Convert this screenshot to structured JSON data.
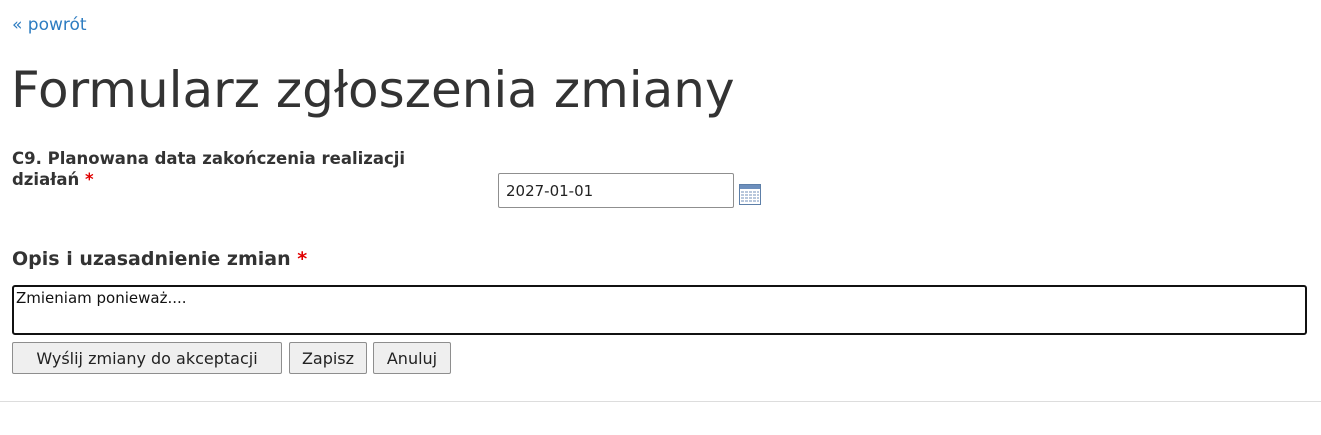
{
  "nav": {
    "back_label": "« powrót"
  },
  "page": {
    "title": "Formularz zgłoszenia zmiany"
  },
  "fields": {
    "end_date": {
      "label": "C9. Planowana data zakończenia realizacji działań",
      "required_mark": "*",
      "value": "2027-01-01",
      "icon": "calendar-icon"
    },
    "description": {
      "label": "Opis i uzasadnienie zmian",
      "required_mark": "*",
      "value": "Zmieniam ponieważ...."
    }
  },
  "actions": {
    "send_label": "Wyślij zmiany do akceptacji",
    "save_label": "Zapisz",
    "cancel_label": "Anuluj"
  },
  "colors": {
    "link": "#2d7cc1",
    "required": "#e00000",
    "text": "#333333"
  }
}
